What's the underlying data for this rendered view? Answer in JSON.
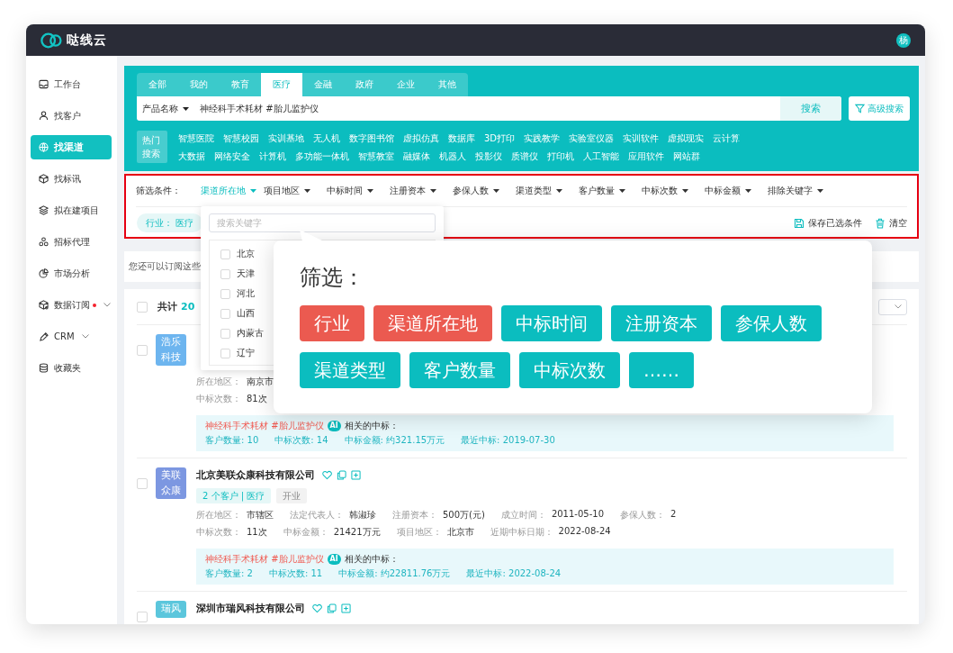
{
  "app": {
    "name": "哒线云",
    "user_initial": "杨"
  },
  "sidebar": {
    "items": [
      {
        "label": "工作台",
        "selected": false,
        "dot": false,
        "expandable": false
      },
      {
        "label": "找客户",
        "selected": false,
        "dot": false,
        "expandable": false
      },
      {
        "label": "找渠道",
        "selected": true,
        "dot": false,
        "expandable": false
      },
      {
        "label": "找标讯",
        "selected": false,
        "dot": false,
        "expandable": false
      },
      {
        "label": "拟在建项目",
        "selected": false,
        "dot": false,
        "expandable": false
      },
      {
        "label": "招标代理",
        "selected": false,
        "dot": false,
        "expandable": false
      },
      {
        "label": "市场分析",
        "selected": false,
        "dot": false,
        "expandable": false
      },
      {
        "label": "数据订阅",
        "selected": false,
        "dot": true,
        "expandable": true
      },
      {
        "label": "CRM",
        "selected": false,
        "dot": false,
        "expandable": true
      },
      {
        "label": "收藏夹",
        "selected": false,
        "dot": false,
        "expandable": false
      }
    ]
  },
  "search": {
    "tabs": [
      {
        "label": "全部",
        "selected": false
      },
      {
        "label": "我的",
        "selected": false
      },
      {
        "label": "教育",
        "selected": false
      },
      {
        "label": "医疗",
        "selected": true
      },
      {
        "label": "金融",
        "selected": false
      },
      {
        "label": "政府",
        "selected": false
      },
      {
        "label": "企业",
        "selected": false
      },
      {
        "label": "其他",
        "selected": false
      }
    ],
    "field_type": "产品名称",
    "query": "神经科手术耗材 #胎儿监护仪",
    "button": "搜索",
    "advanced_button": "高级搜索",
    "hot_label": "热门搜索",
    "hot_rows": [
      [
        "智慧医院",
        "智慧校园",
        "实训基地",
        "无人机",
        "数字图书馆",
        "虚拟仿真",
        "数据库",
        "3D打印",
        "实践教学",
        "实验室仪器",
        "实训软件",
        "虚拟现实",
        "云计算"
      ],
      [
        "大数据",
        "网络安全",
        "计算机",
        "多功能一体机",
        "智慧教室",
        "融媒体",
        "机器人",
        "投影仪",
        "质谱仪",
        "打印机",
        "人工智能",
        "应用软件",
        "网站群"
      ]
    ]
  },
  "filters": {
    "highlighted": true,
    "label": "筛选条件：",
    "dropdowns": [
      {
        "label": "渠道所在地",
        "open": true
      },
      {
        "label": "项目地区",
        "open": false
      },
      {
        "label": "中标时间",
        "open": false
      },
      {
        "label": "注册资本",
        "open": false
      },
      {
        "label": "参保人数",
        "open": false
      },
      {
        "label": "渠道类型",
        "open": false
      },
      {
        "label": "客户数量",
        "open": false
      },
      {
        "label": "中标次数",
        "open": false
      },
      {
        "label": "中标金额",
        "open": false
      },
      {
        "label": "排除关键字",
        "open": false
      }
    ],
    "chips": [
      {
        "key": "行业：",
        "value": "医疗"
      }
    ],
    "save_button": "保存已选条件",
    "clear_button": "清空"
  },
  "location_menu": {
    "placeholder": "搜索关键字",
    "options": [
      {
        "label": "北京",
        "checked": false
      },
      {
        "label": "天津",
        "checked": false
      },
      {
        "label": "河北",
        "checked": false
      },
      {
        "label": "山西",
        "checked": false
      },
      {
        "label": "内蒙古",
        "checked": false
      },
      {
        "label": "辽宁",
        "checked": false
      }
    ]
  },
  "subscribe_hint": "您还可以订阅这些",
  "results": {
    "select_all_checked": false,
    "total_label": "共计",
    "total_count": "20",
    "rows": [
      {
        "checked": false,
        "avatar": "浩乐科技",
        "color": "#6db5ef",
        "info_lines": [
          [
            {
              "label": "所在地区：",
              "value": "南京市"
            }
          ],
          [
            {
              "label": "中标次数：",
              "value": "81次"
            }
          ]
        ],
        "related": {
          "keywords": "神经科手术耗材 #胎儿监护仪",
          "badge": "AI",
          "label": "相关的中标：",
          "stats": [
            "客户数量: 10",
            "中标次数: 14",
            "中标金额: 约321.15万元",
            "最近中标: 2019-07-30"
          ]
        }
      },
      {
        "checked": false,
        "avatar": "美联众康",
        "color": "#7c97e1",
        "name": "北京美联众康科技有限公司",
        "tags": [
          {
            "text": "2 个客户 | 医疗",
            "kind": "scope"
          },
          {
            "text": "开业",
            "kind": "status"
          }
        ],
        "info_lines": [
          [
            {
              "label": "所在地区：",
              "value": "市辖区"
            },
            {
              "label": "法定代表人：",
              "value": "韩淑珍"
            },
            {
              "label": "注册资本：",
              "value": "500万(元)"
            },
            {
              "label": "成立时间：",
              "value": "2011-05-10"
            },
            {
              "label": "参保人数：",
              "value": "2"
            }
          ],
          [
            {
              "label": "中标次数：",
              "value": "11次"
            },
            {
              "label": "中标金额：",
              "value": "21421万元"
            },
            {
              "label": "项目地区：",
              "value": "北京市"
            },
            {
              "label": "近期中标日期：",
              "value": "2022-08-24"
            }
          ]
        ],
        "related": {
          "keywords": "神经科手术耗材 #胎儿监护仪",
          "badge": "AI",
          "label": "相关的中标：",
          "stats": [
            "客户数量: 2",
            "中标次数: 11",
            "中标金额: 约22811.76万元",
            "最近中标: 2022-08-24"
          ]
        }
      },
      {
        "checked": false,
        "avatar": "瑞风",
        "color": "#5bc6dc",
        "name": "深圳市瑞风科技有限公司"
      }
    ]
  },
  "callout": {
    "title": "筛选：",
    "tags": [
      {
        "text": "行业",
        "color": "#eb5a50"
      },
      {
        "text": "渠道所在地",
        "color": "#eb5a50"
      },
      {
        "text": "中标时间",
        "color": "#0bbdbf"
      },
      {
        "text": "注册资本",
        "color": "#0bbdbf"
      },
      {
        "text": "参保人数",
        "color": "#0bbdbf"
      },
      {
        "text": "渠道类型",
        "color": "#0bbdbf"
      },
      {
        "text": "客户数量",
        "color": "#0bbdbf"
      },
      {
        "text": "中标次数",
        "color": "#0bbdbf"
      },
      {
        "text": "……",
        "color": "#0bbdbf"
      }
    ]
  }
}
